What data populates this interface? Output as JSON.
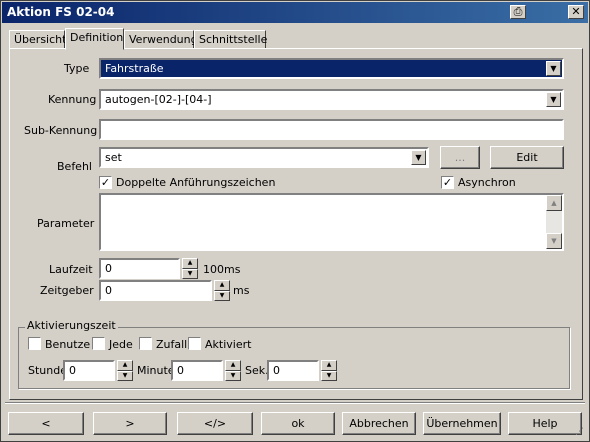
{
  "window": {
    "title": "Aktion FS 02-04"
  },
  "tabs": [
    {
      "label": "Übersicht"
    },
    {
      "label": "Definition"
    },
    {
      "label": "Verwendung"
    },
    {
      "label": "Schnittstelle"
    }
  ],
  "form": {
    "type_label": "Type",
    "type_value": "Fahrstraße",
    "kennung_label": "Kennung",
    "kennung_value": "autogen-[02-]-[04-]",
    "subkennung_label": "Sub-Kennung",
    "subkennung_value": "",
    "befehl_label": "Befehl",
    "befehl_value": "set",
    "browse_label": "...",
    "edit_label": "Edit",
    "doppelte_label": "Doppelte Anführungszeichen",
    "doppelte_checked": true,
    "asynchron_label": "Asynchron",
    "asynchron_checked": true,
    "parameter_label": "Parameter",
    "parameter_value": "",
    "laufzeit_label": "Laufzeit",
    "laufzeit_value": "0",
    "laufzeit_unit": "100ms",
    "zeitgeber_label": "Zeitgeber",
    "zeitgeber_value": "0",
    "zeitgeber_unit": "ms"
  },
  "aktivierung": {
    "group_label": "Aktivierungszeit",
    "benutze_label": "Benutze",
    "jede_label": "Jede",
    "zufall_label": "Zufall",
    "aktiviert_label": "Aktiviert",
    "stunde_label": "Stunde",
    "stunde_value": "0",
    "minute_label": "Minute",
    "minute_value": "0",
    "sek_label": "Sek.",
    "sek_value": "0"
  },
  "buttons": {
    "prev": "<",
    "next": ">",
    "code": "</>",
    "ok": "ok",
    "abbrechen": "Abbrechen",
    "uebernehmen": "Übernehmen",
    "help": "Help"
  },
  "icons": {
    "print": "printer-icon",
    "close": "close-icon"
  }
}
